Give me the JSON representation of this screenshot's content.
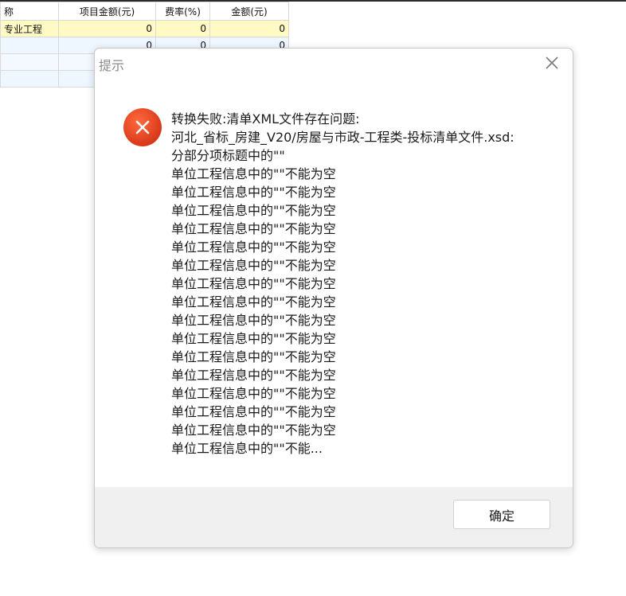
{
  "table": {
    "columns": [
      "称",
      "项目金额(元)",
      "费率(%)",
      "金额(元)"
    ],
    "rows": [
      [
        "专业工程",
        "0",
        "0",
        "0"
      ],
      [
        "",
        "0",
        "0",
        "0"
      ],
      [
        "",
        "",
        "",
        ""
      ],
      [
        "",
        "",
        "",
        ""
      ]
    ]
  },
  "dialog": {
    "title": "提示",
    "icon": "error-icon",
    "message_lines": [
      "转换失败:清单XML文件存在问题:",
      "河北_省标_房建_V20/房屋与市政-工程类-投标清单文件.xsd:",
      "分部分项标题中的\"\"",
      "单位工程信息中的\"\"不能为空",
      "单位工程信息中的\"\"不能为空",
      "单位工程信息中的\"\"不能为空",
      "单位工程信息中的\"\"不能为空",
      "单位工程信息中的\"\"不能为空",
      "单位工程信息中的\"\"不能为空",
      "单位工程信息中的\"\"不能为空",
      "单位工程信息中的\"\"不能为空",
      "单位工程信息中的\"\"不能为空",
      "单位工程信息中的\"\"不能为空",
      "单位工程信息中的\"\"不能为空",
      "单位工程信息中的\"\"不能为空",
      "单位工程信息中的\"\"不能为空",
      "单位工程信息中的\"\"不能为空",
      "单位工程信息中的\"\"不能为空",
      "单位工程信息中的\"\"不能..."
    ],
    "ok_label": "确定"
  }
}
